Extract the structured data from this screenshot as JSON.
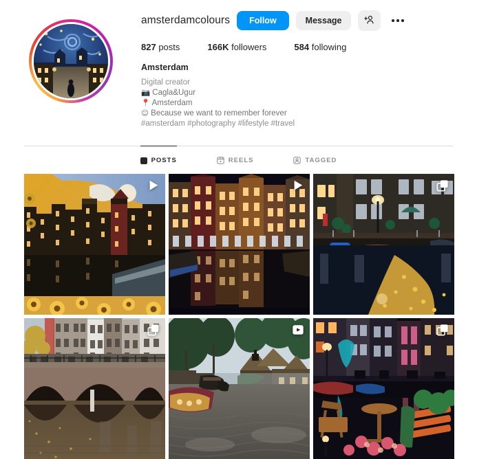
{
  "profile": {
    "username": "amsterdamcolours",
    "full_name": "Amsterdam",
    "category": "Digital creator",
    "bio_lines": [
      {
        "emoji": "📷",
        "text": "Cagla&Ugur"
      },
      {
        "emoji": "📍",
        "text": "Amsterdam"
      },
      {
        "emoji": "☺",
        "text": "Because we want to remember forever"
      }
    ],
    "hashtags": "#amsterdam #photography #lifestyle #travel",
    "avatar_alt": "starry-night-amsterdam-street-avatar",
    "story_ring": true
  },
  "actions": {
    "follow_label": "Follow",
    "message_label": "Message",
    "add_person_icon": "add-person-icon",
    "more_options_icon": "more-options-icon",
    "follow_color": "#0095f6",
    "secondary_color": "#efefef"
  },
  "stats": [
    {
      "value": "827",
      "label": "posts"
    },
    {
      "value": "166K",
      "label": "followers"
    },
    {
      "value": "584",
      "label": "following"
    }
  ],
  "tabs": [
    {
      "label": "POSTS",
      "icon": "grid-icon",
      "active": true
    },
    {
      "label": "REELS",
      "icon": "reels-icon",
      "active": false
    },
    {
      "label": "TAGGED",
      "icon": "tagged-icon",
      "active": false
    }
  ],
  "grid": {
    "posts": [
      {
        "name": "post-vangogh-canal-houses-sunflowers",
        "badge": "reel-icon",
        "theme": "vangogh"
      },
      {
        "name": "post-night-canal-houses-reflection",
        "badge": "reel-icon",
        "theme": "nighthouses"
      },
      {
        "name": "post-canal-golden-leaves-night",
        "badge": "carousel-icon",
        "theme": "goldenleaves"
      },
      {
        "name": "post-canal-bridge-arches-autumn",
        "badge": "carousel-icon",
        "theme": "bridge"
      },
      {
        "name": "post-giethoorn-village-canal",
        "badge": "reel-icon",
        "theme": "giethoorn"
      },
      {
        "name": "post-canal-cafe-terrace-night",
        "badge": "carousel-icon",
        "theme": "terrace"
      }
    ]
  },
  "colors": {
    "text_primary": "#262626",
    "text_secondary": "#8e8e8e",
    "divider": "#dbdbdb",
    "accent_blue": "#0095f6"
  }
}
